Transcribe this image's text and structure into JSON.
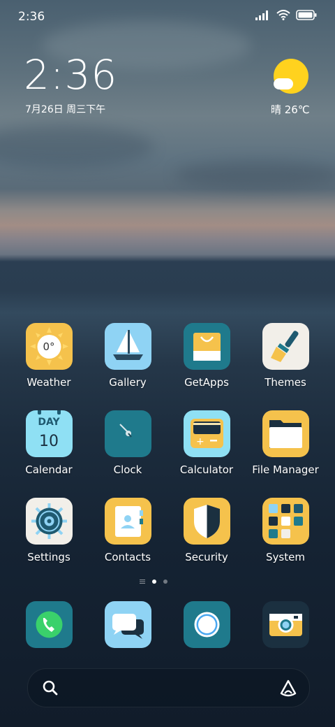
{
  "status_bar": {
    "time": "2:36"
  },
  "lockclock": {
    "time": "2:36",
    "date": "7月26日 周三下午"
  },
  "weather_widget": {
    "condition_temp": "晴 26℃"
  },
  "apps": [
    {
      "label": "Weather"
    },
    {
      "label": "Gallery"
    },
    {
      "label": "GetApps"
    },
    {
      "label": "Themes"
    },
    {
      "label": "Calendar"
    },
    {
      "label": "Clock"
    },
    {
      "label": "Calculator"
    },
    {
      "label": "File Manager"
    },
    {
      "label": "Settings"
    },
    {
      "label": "Contacts"
    },
    {
      "label": "Security"
    },
    {
      "label": "System"
    }
  ],
  "weather_icon_text": "0°",
  "calendar_icon": {
    "day_label": "DAY",
    "day_number": "10"
  },
  "page_indicator": {
    "pages": 2,
    "active": 1
  },
  "dock": [
    {
      "icon": "phone-icon"
    },
    {
      "icon": "messages-icon"
    },
    {
      "icon": "browser-icon"
    },
    {
      "icon": "camera-icon"
    }
  ],
  "colors": {
    "accent_yellow": "#f5c24c",
    "teal": "#1f7a8c",
    "light_blue": "#8fd3f4"
  }
}
